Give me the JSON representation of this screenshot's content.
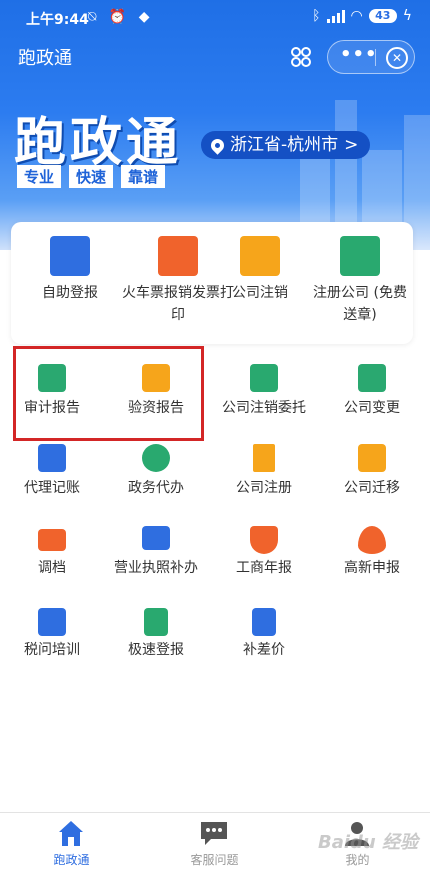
{
  "status_bar": {
    "time": "上午9:44",
    "icons": "⍉ ⏰ ◆",
    "battery": "43"
  },
  "nav": {
    "title": "跑政通",
    "scan_icon": "scan-icon",
    "more_label": "•••",
    "close_label": "✕"
  },
  "hero": {
    "brand": "跑政通",
    "tags": [
      "专业",
      "快速",
      "靠谱"
    ],
    "location": "浙江省-杭州市",
    "location_arrow": ">"
  },
  "featured": [
    {
      "label": "自助登报",
      "color": "#2f6ee0",
      "icon": "newspaper-icon"
    },
    {
      "label": "火车票报销发票打印",
      "color": "#f0632c",
      "icon": "train-icon"
    },
    {
      "label": "公司注销",
      "color": "#f6a51b",
      "icon": "briefcase-clock-icon"
    },
    {
      "label": "注册公司 (免费送章)",
      "color": "#29a96f",
      "icon": "briefcase-icon"
    }
  ],
  "services": [
    {
      "label": "审计报告",
      "color": "#2aa870",
      "icon": "audit-report-icon"
    },
    {
      "label": "验资报告",
      "color": "#f6a51b",
      "icon": "capital-verification-icon"
    },
    {
      "label": "公司注销委托",
      "color": "#29a96f",
      "icon": "briefcase-clock-icon"
    },
    {
      "label": "公司变更",
      "color": "#2aa870",
      "icon": "change-icon"
    },
    {
      "label": "代理记账",
      "color": "#2f6ee0",
      "icon": "bookkeeping-icon"
    },
    {
      "label": "政务代办",
      "color": "#29a96f",
      "icon": "runner-icon"
    },
    {
      "label": "公司注册",
      "color": "#f6a51b",
      "icon": "building-icon"
    },
    {
      "label": "公司迁移",
      "color": "#f6a51b",
      "icon": "briefcase-move-icon"
    },
    {
      "label": "调档",
      "color": "#f0632c",
      "icon": "id-card-icon"
    },
    {
      "label": "营业执照补办",
      "color": "#2f6ee0",
      "icon": "license-icon"
    },
    {
      "label": "工商年报",
      "color": "#f0632c",
      "icon": "shield-icon"
    },
    {
      "label": "高新申报",
      "color": "#f0632c",
      "icon": "flame-icon"
    },
    {
      "label": "税问培训",
      "color": "#2f6ee0",
      "icon": "layers-icon"
    },
    {
      "label": "极速登报",
      "color": "#29a96f",
      "icon": "document-icon"
    },
    {
      "label": "补差价",
      "color": "#2f6ee0",
      "icon": "price-add-icon"
    }
  ],
  "tabs": [
    {
      "label": "跑政通",
      "icon": "home-icon",
      "active": true
    },
    {
      "label": "客服问题",
      "icon": "chat-icon",
      "active": false
    },
    {
      "label": "我的",
      "icon": "user-icon",
      "active": false
    }
  ],
  "watermark": "Baidu 经验"
}
